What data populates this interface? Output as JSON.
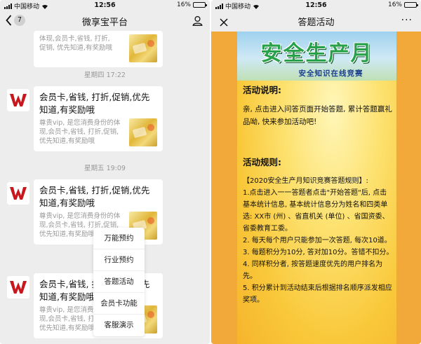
{
  "left": {
    "status": {
      "carrier": "中国移动",
      "time": "12:56",
      "battery": "16%",
      "battery_level": 0.16
    },
    "nav": {
      "back_badge": "7",
      "title": "微享宝平台"
    },
    "top_card": {
      "desc": "体现,会员卡,省钱, 打折,\n促销, 优先知道,有奖励哦"
    },
    "time1": "星期四 17:22",
    "card1": {
      "title": "会员卡,省钱, 打折,促销,优先知道,有奖励哦",
      "desc": "尊贵vip, 是您消费身份的体现,会员卡,省钱, 打折,促销, 优先知道,有奖励哦"
    },
    "time2": "星期五 19:09",
    "card2": {
      "title": "会员卡,省钱, 打折,促销,优先知道,有奖励哦",
      "desc": "尊贵vip, 是您消费身份的体现,会员卡,省钱, 打折,促销, 优先知道,有奖励哦"
    },
    "card3": {
      "title": "会员卡,省钱, 打折,促销,优先知道,有奖励哦",
      "desc": "尊贵vip, 是您消费身份的体现,会员卡,省钱, 打折,促销, 优先知道,有奖励哦"
    },
    "menu": [
      "万能预约",
      "行业预约",
      "答题活动",
      "会员卡功能",
      "客服演示"
    ]
  },
  "right": {
    "status": {
      "carrier": "中国移动",
      "time": "12:56",
      "battery": "16%",
      "battery_level": 0.16
    },
    "nav": {
      "title": "答题活动",
      "more": "···"
    },
    "banner": {
      "title": "安全生产月",
      "subtitle": "安全知识在线竞赛"
    },
    "desc_title": "活动说明:",
    "desc_text": "亲, 点击进入问答页面开始答题, 累计答题赢礼品呦, 快来参加活动吧!",
    "rules_title": "活动规则:",
    "rules": [
      "【2020安全生产月知识竞赛答题规则】:",
      "1.点击进入一一答题者点击\"开始答题\"后, 点击基本统计信息, 基本统计信息分为姓名和四类单选: XX市 (州) 、省直机关 (单位) 、省国资委、省委教育工委。",
      "2. 每天每个用户只能参加一次答题, 每次10道。",
      "3. 每题积分为10分, 答对加10分。答错不扣分。",
      "4. 同样积分者, 按答题速度优先的用户排名为先。",
      "5. 积分累计到活动结束后根据排名顺序派发相应奖项。"
    ]
  },
  "colors": {
    "logo_red": "#c9171e",
    "banner_green": "#27a24a",
    "banner_blue": "#1a3e8c",
    "side_orange": "#f3a83a"
  },
  "icons": {
    "back": "chevron-left-icon",
    "person": "person-icon",
    "close": "close-icon",
    "more": "more-icon",
    "logo": "w-logo-icon"
  }
}
